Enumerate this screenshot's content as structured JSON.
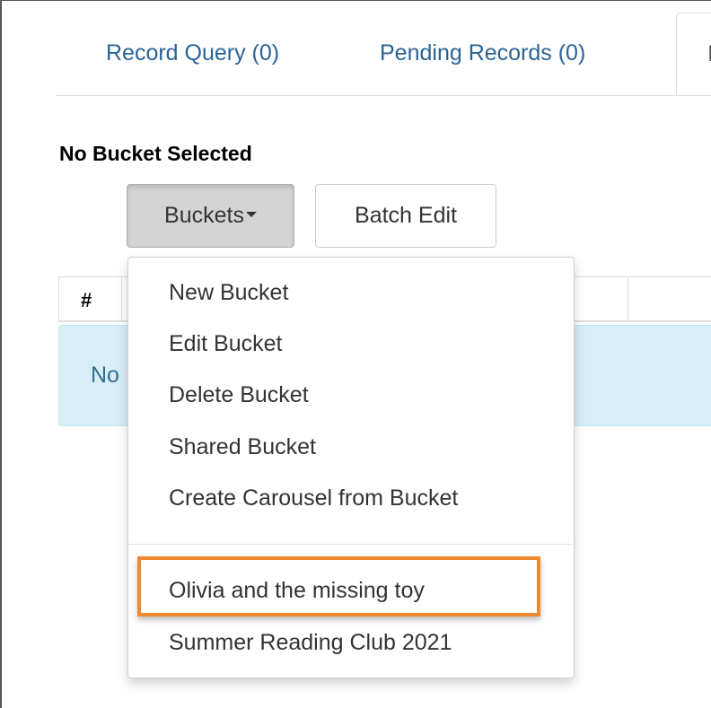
{
  "tabs": [
    {
      "label": "Record Query (0)"
    },
    {
      "label": "Pending Records (0)"
    },
    {
      "label": "I"
    }
  ],
  "bucket_heading": "No Bucket Selected",
  "toolbar": {
    "buckets_label": "Buckets",
    "batch_edit_label": "Batch Edit"
  },
  "table": {
    "columns": [
      "#"
    ],
    "empty_text": "No"
  },
  "buckets_menu": {
    "actions": [
      "New Bucket",
      "Edit Bucket",
      "Delete Bucket",
      "Shared Bucket",
      "Create Carousel from Bucket"
    ],
    "buckets": [
      "Olivia and the missing toy",
      "Summer Reading Club 2021"
    ]
  },
  "colors": {
    "link": "#2a6496",
    "highlight": "#f0882f",
    "info_bg": "#d9edf7"
  }
}
